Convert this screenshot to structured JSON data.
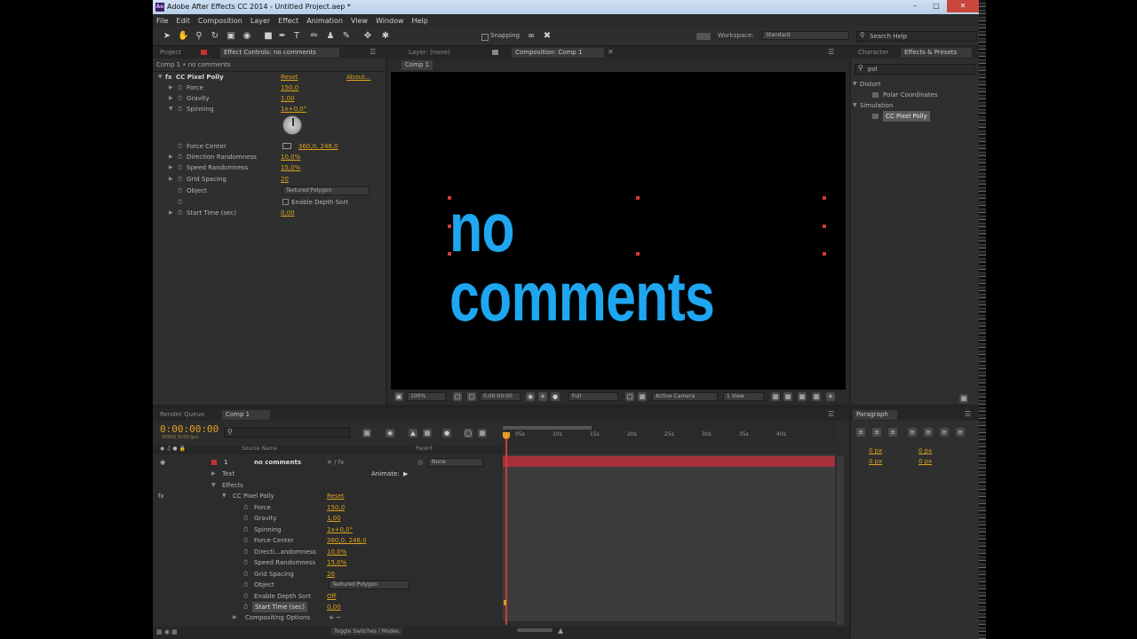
{
  "window": {
    "title": "Adobe After Effects CC 2014 - Untitled Project.aep *",
    "logo_text": "Ae"
  },
  "menu": [
    "File",
    "Edit",
    "Composition",
    "Layer",
    "Effect",
    "Animation",
    "View",
    "Window",
    "Help"
  ],
  "toolbar": {
    "snapping_label": "Snapping",
    "workspace_label": "Workspace:",
    "workspace_value": "Standard",
    "search_placeholder": "Search Help"
  },
  "left_panel": {
    "tabs": [
      "Project",
      "Effect Controls: no comments"
    ],
    "breadcrumb": "Comp 1 • no comments",
    "effect": {
      "name": "CC Pixel Polly",
      "reset": "Reset",
      "about": "About..."
    },
    "props": [
      {
        "name": "Force",
        "value": "150,0"
      },
      {
        "name": "Gravity",
        "value": "1,00"
      },
      {
        "name": "Spinning",
        "value": "1x+0,0°"
      },
      {
        "name": "Force Center",
        "value": "360,0, 248,0"
      },
      {
        "name": "Direction Randomness",
        "value": "10,0%"
      },
      {
        "name": "Speed Randomness",
        "value": "15,0%"
      },
      {
        "name": "Grid Spacing",
        "value": "20"
      },
      {
        "name": "Object",
        "value": "Textured Polygon"
      },
      {
        "name": "Enable Depth Sort",
        "value": "Enable Depth Sort"
      },
      {
        "name": "Start Time (sec)",
        "value": "0,00"
      }
    ]
  },
  "center_panel": {
    "tabs": [
      "Layer: (none)",
      "Composition: Comp 1"
    ],
    "subtab": "Comp 1",
    "comp_text": "no comments",
    "footer": {
      "zoom": "100%",
      "timecode": "0:00:00:00",
      "resolution": "Full",
      "camera": "Active Camera",
      "views": "1 View"
    }
  },
  "right_panel": {
    "tabs": [
      "Character",
      "Effects & Presets"
    ],
    "search_value": "pol",
    "tree": [
      {
        "label": "Distort",
        "level": 0
      },
      {
        "label": "Polar Coordinates",
        "level": 1
      },
      {
        "label": "Simulation",
        "level": 0
      },
      {
        "label": "CC Pixel Polly",
        "level": 1
      }
    ]
  },
  "timeline": {
    "tabs": [
      "Render Queue",
      "Comp 1"
    ],
    "timecode": "0:00:00:00",
    "timecode_sub": "00000 (0.00 fps)",
    "columns": {
      "source_name": "Source Name",
      "parent": "Parent"
    },
    "layer": {
      "index": "1",
      "name": "no comments",
      "parent": "None"
    },
    "rows": [
      {
        "label": "Text",
        "value": "",
        "extra": "Animate:"
      },
      {
        "label": "Effects",
        "value": ""
      },
      {
        "label": "CC Pixel Polly",
        "value": "Reset"
      },
      {
        "label": "Force",
        "value": "150,0"
      },
      {
        "label": "Gravity",
        "value": "1,00"
      },
      {
        "label": "Spinning",
        "value": "1x+0,0°"
      },
      {
        "label": "Force Center",
        "value": "360,0, 248,0"
      },
      {
        "label": "Directi...andomness",
        "value": "10,0%"
      },
      {
        "label": "Speed Randomness",
        "value": "15,0%"
      },
      {
        "label": "Grid Spacing",
        "value": "20"
      },
      {
        "label": "Object",
        "value": "Textured Polygon"
      },
      {
        "label": "Enable Depth Sort",
        "value": "Off"
      },
      {
        "label": "Start Time (sec)",
        "value": "0,00"
      },
      {
        "label": "Compositing Options",
        "value": "+ −"
      }
    ],
    "ruler": [
      "0s",
      "05s",
      "10s",
      "15s",
      "20s",
      "25s",
      "30s",
      "35s",
      "40s"
    ],
    "footer_toggle": "Toggle Switches / Modes"
  },
  "paragraph_panel": {
    "tab": "Paragraph",
    "fields": [
      "0 px",
      "0 px",
      "0 px",
      "0 px"
    ]
  }
}
